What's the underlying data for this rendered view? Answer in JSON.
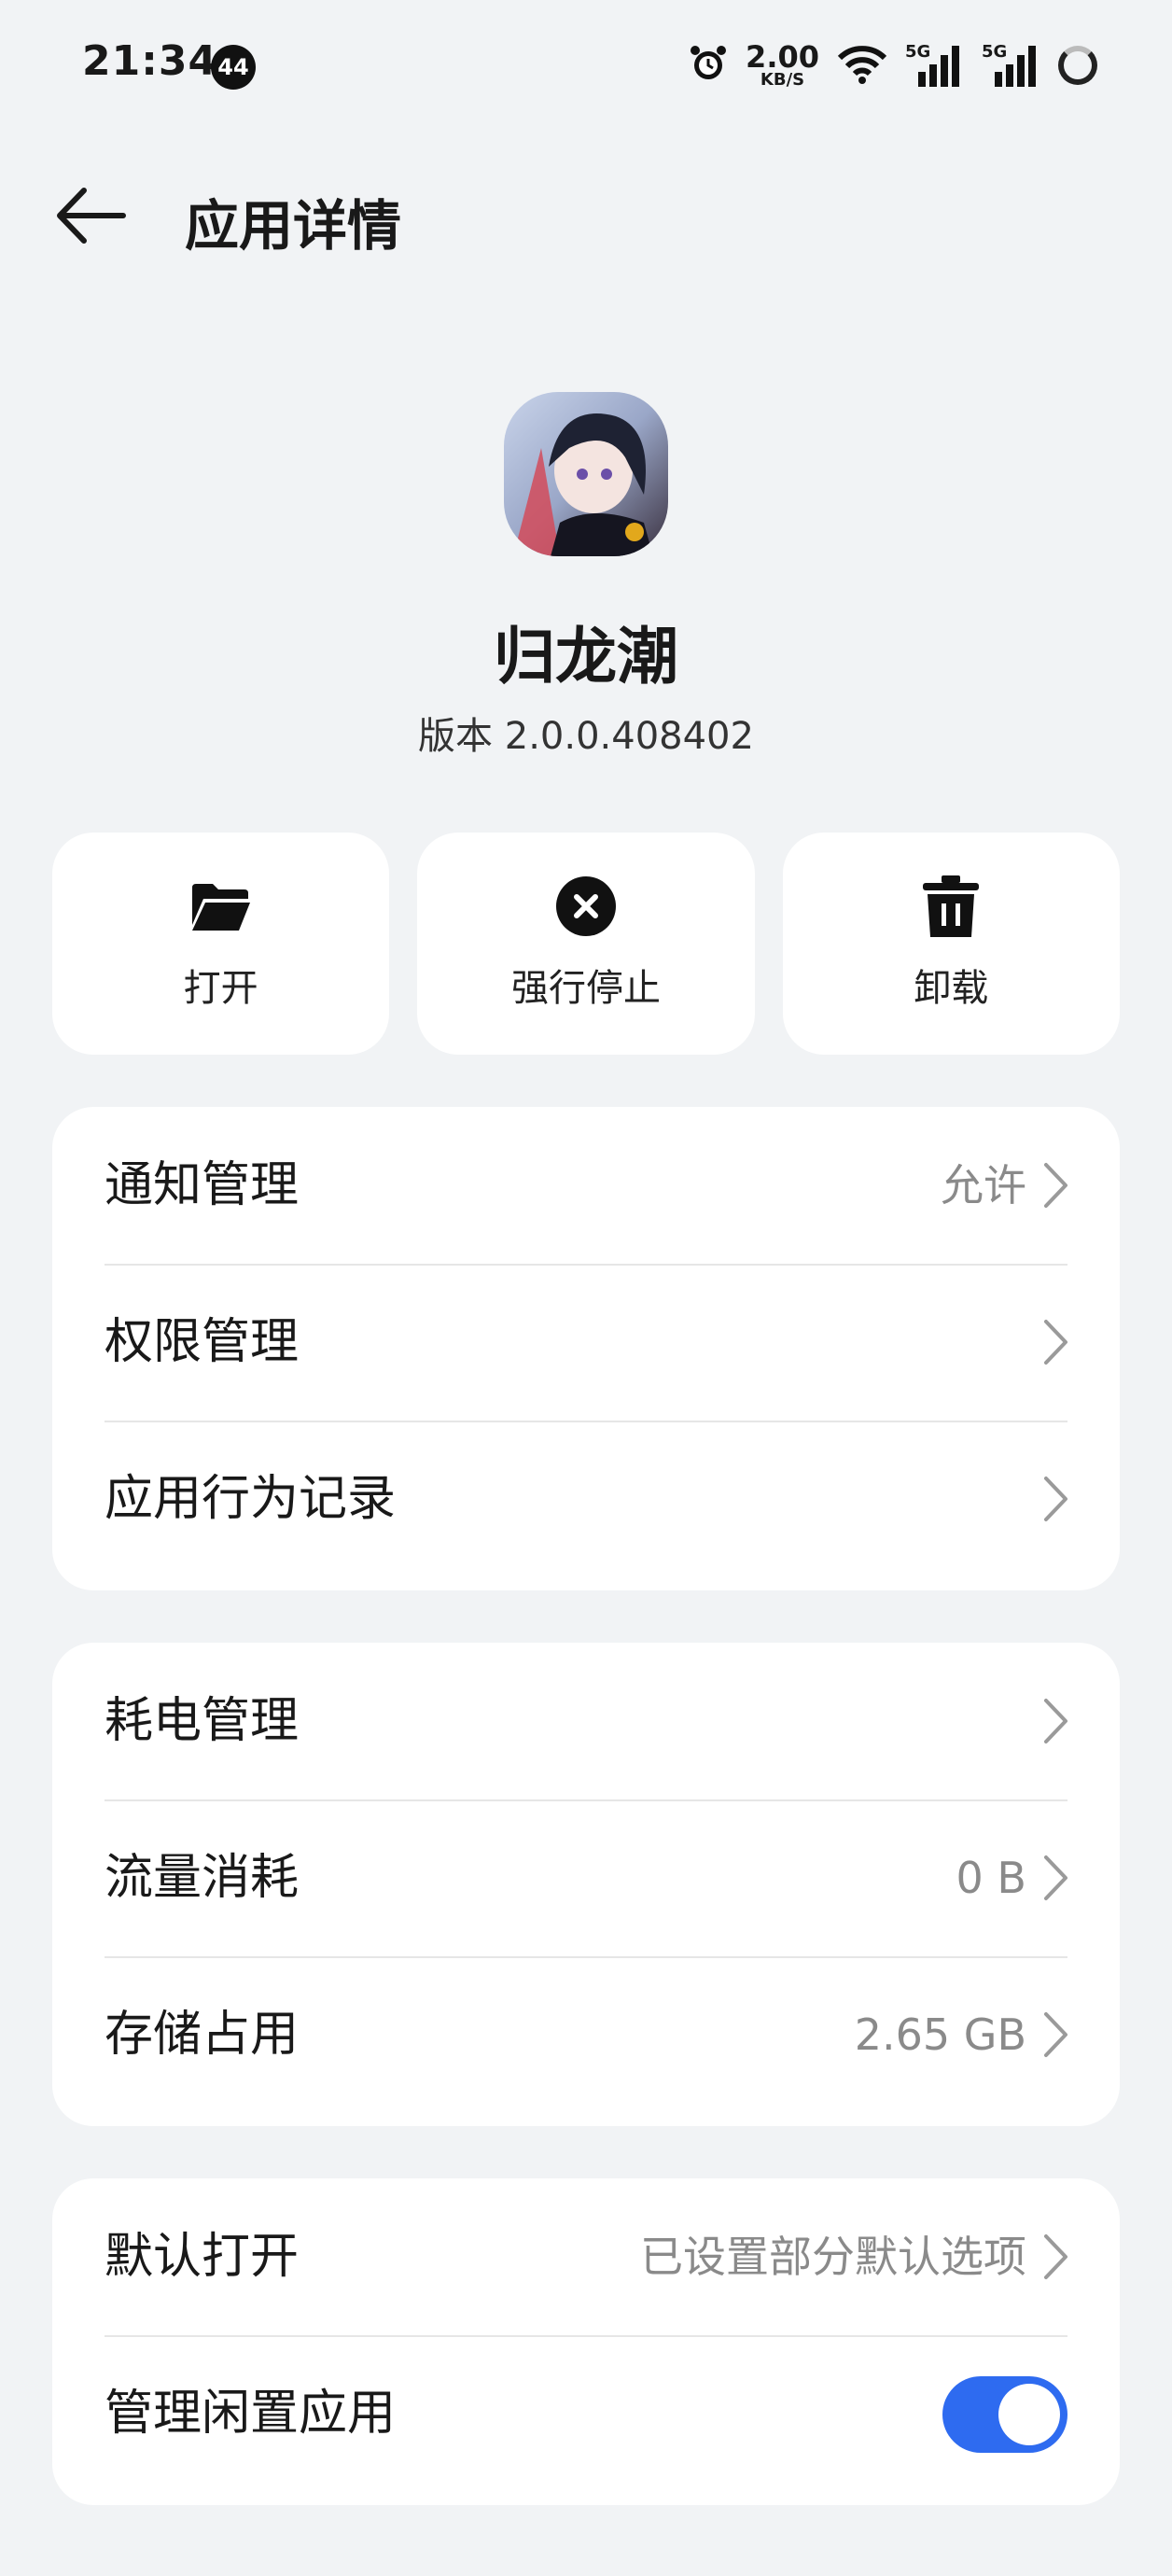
{
  "status_bar": {
    "time": "21:34",
    "notification_count": "44",
    "net_speed_value": "2.00",
    "net_speed_unit": "KB/S",
    "sim1_label": "5G",
    "sim2_label": "5G",
    "icons": [
      "alarm-icon",
      "wifi-icon",
      "signal-icon",
      "signal-icon",
      "battery-icon"
    ]
  },
  "header": {
    "title": "应用详情"
  },
  "app": {
    "name": "归龙潮",
    "version": "版本 2.0.0.408402"
  },
  "actions": [
    {
      "label": "打开",
      "icon": "folder-open-icon"
    },
    {
      "label": "强行停止",
      "icon": "force-stop-icon"
    },
    {
      "label": "卸载",
      "icon": "trash-icon"
    }
  ],
  "group1": [
    {
      "label": "通知管理",
      "value": "允许"
    },
    {
      "label": "权限管理",
      "value": ""
    },
    {
      "label": "应用行为记录",
      "value": ""
    }
  ],
  "group2": [
    {
      "label": "耗电管理",
      "value": ""
    },
    {
      "label": "流量消耗",
      "value": "0 B"
    },
    {
      "label": "存储占用",
      "value": "2.65 GB"
    }
  ],
  "group3": [
    {
      "label": "默认打开",
      "value": "已设置部分默认选项"
    },
    {
      "label": "管理闲置应用",
      "toggle_on": true
    }
  ],
  "colors": {
    "accent": "#2e6bf0",
    "background": "#f1f3f5",
    "card": "#ffffff"
  }
}
